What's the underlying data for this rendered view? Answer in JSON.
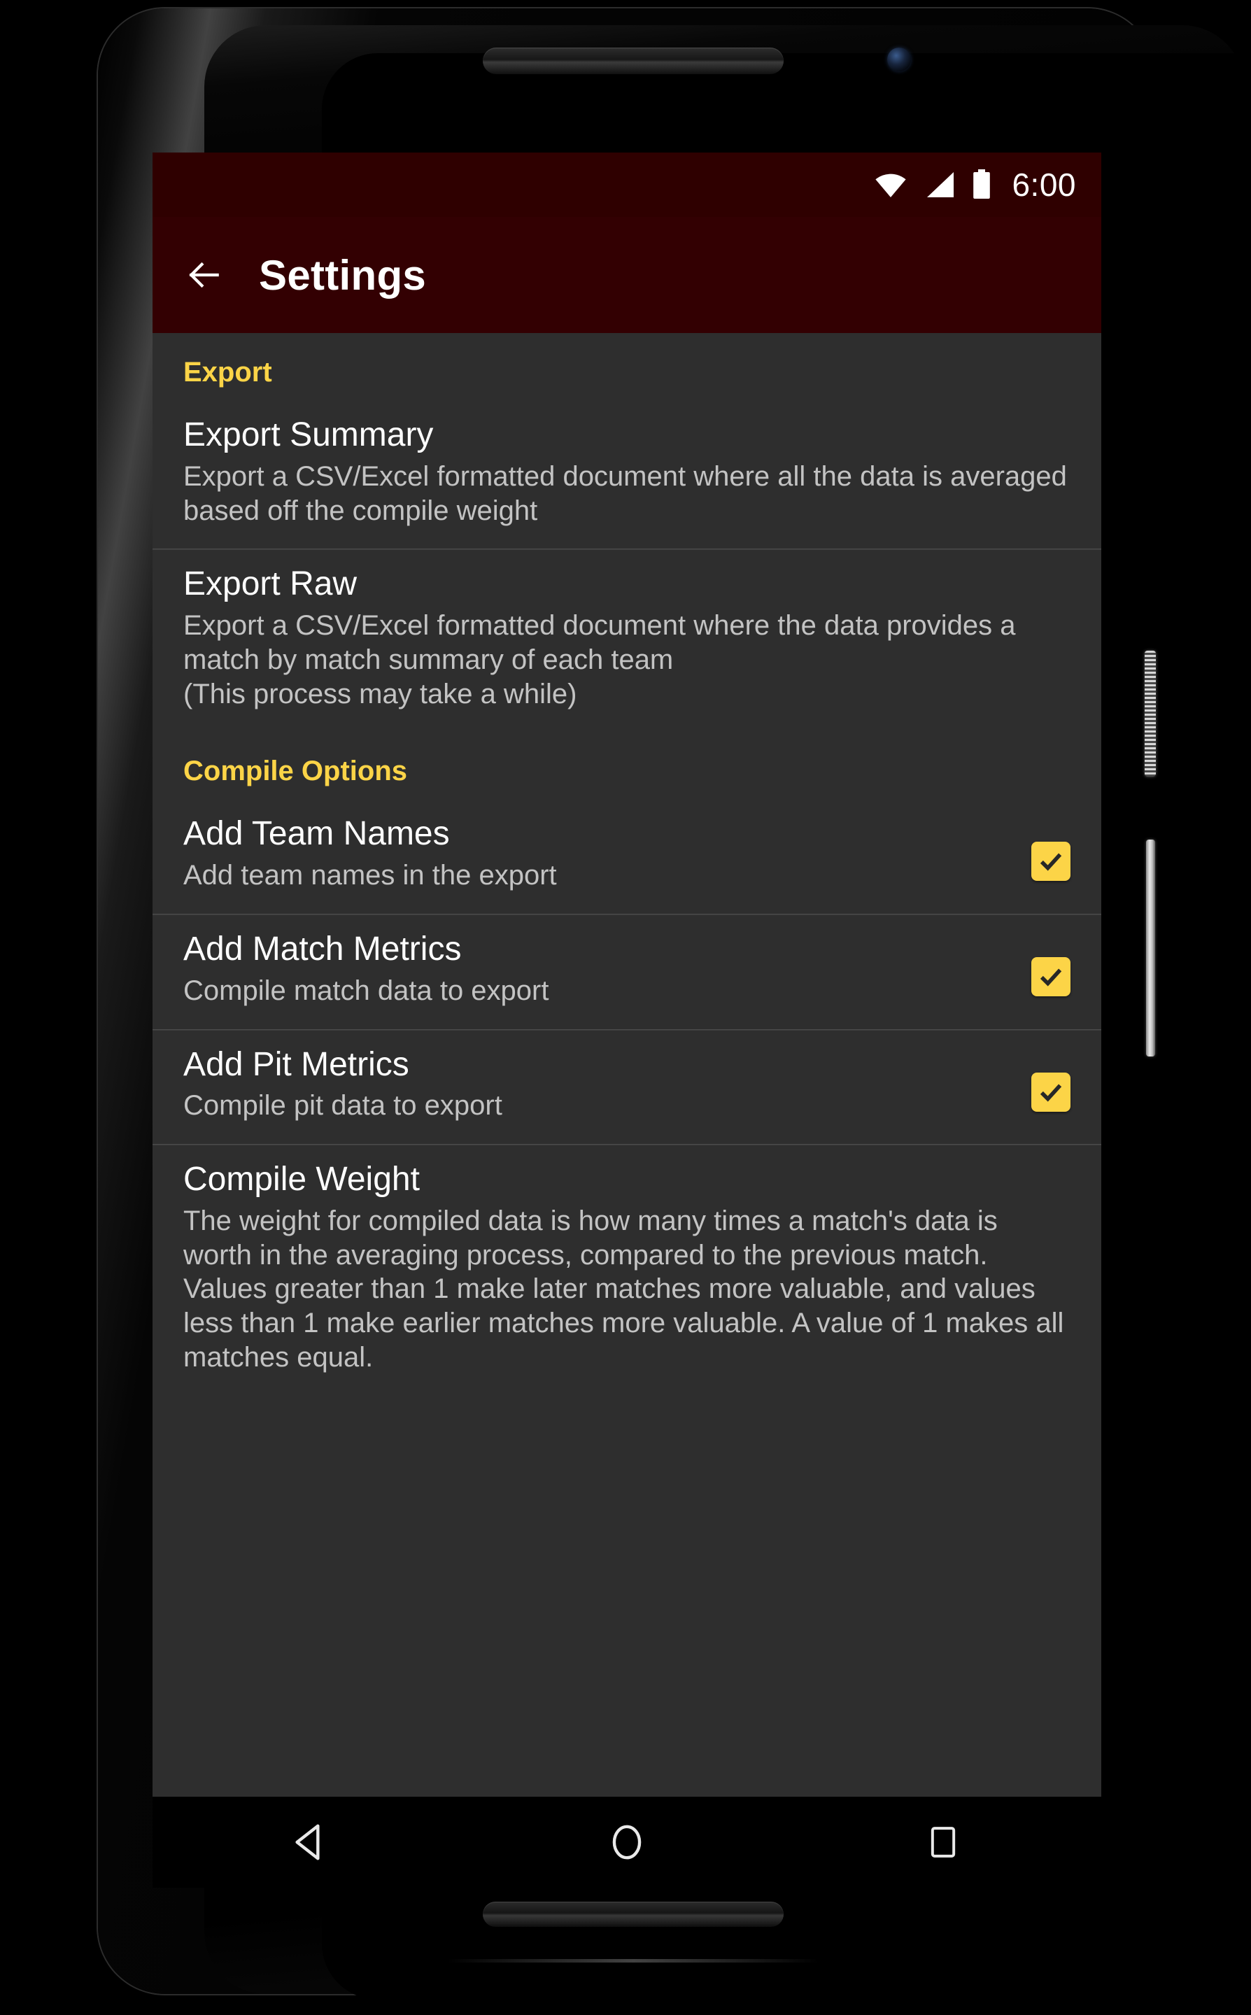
{
  "device": {
    "hardware": {
      "earpiece": "earpiece-speaker",
      "front_camera": "front-camera",
      "power_button": "power-button",
      "volume_button": "volume-button",
      "bottom_speaker": "bottom-speaker"
    }
  },
  "status_bar": {
    "time": "6:00",
    "icons": [
      "wifi-icon",
      "signal-icon",
      "battery-icon"
    ],
    "background": "#2F0000"
  },
  "app_bar": {
    "back_icon": "back-arrow-icon",
    "title": "Settings",
    "background": "#330002"
  },
  "theme": {
    "accent": "#FCD447",
    "screen_background": "#2E2E2E",
    "title_text": "#FFFFFF",
    "subtitle_text": "#C3C3C3",
    "divider": "#4B4B4B"
  },
  "sections": [
    {
      "header": "Export",
      "items": [
        {
          "title": "Export Summary",
          "subtitle": "Export a CSV/Excel formatted document where all the data is averaged based off the compile weight",
          "checkbox": null
        },
        {
          "title": "Export Raw",
          "subtitle": "Export a CSV/Excel formatted document where the data provides a match by match summary of each team\n(This process may take a while)",
          "checkbox": null
        }
      ]
    },
    {
      "header": "Compile Options",
      "items": [
        {
          "title": "Add Team Names",
          "subtitle": "Add team names in the export",
          "checkbox": {
            "checked": true,
            "label": "checkbox-add-team-names"
          }
        },
        {
          "title": "Add Match Metrics",
          "subtitle": "Compile match data to export",
          "checkbox": {
            "checked": true,
            "label": "checkbox-add-match-metrics"
          }
        },
        {
          "title": "Add Pit Metrics",
          "subtitle": "Compile pit data to export",
          "checkbox": {
            "checked": true,
            "label": "checkbox-add-pit-metrics"
          }
        },
        {
          "title": "Compile Weight",
          "subtitle": "The weight for compiled data is how many times a match's data is worth in the averaging process, compared to the previous match. Values greater than 1 make later matches more valuable, and values less than 1 make earlier matches more valuable. A value of 1 makes all matches equal.",
          "checkbox": null
        }
      ]
    }
  ],
  "nav_bar": {
    "back": "nav-back-icon",
    "home": "nav-home-icon",
    "recents": "nav-recents-icon"
  }
}
